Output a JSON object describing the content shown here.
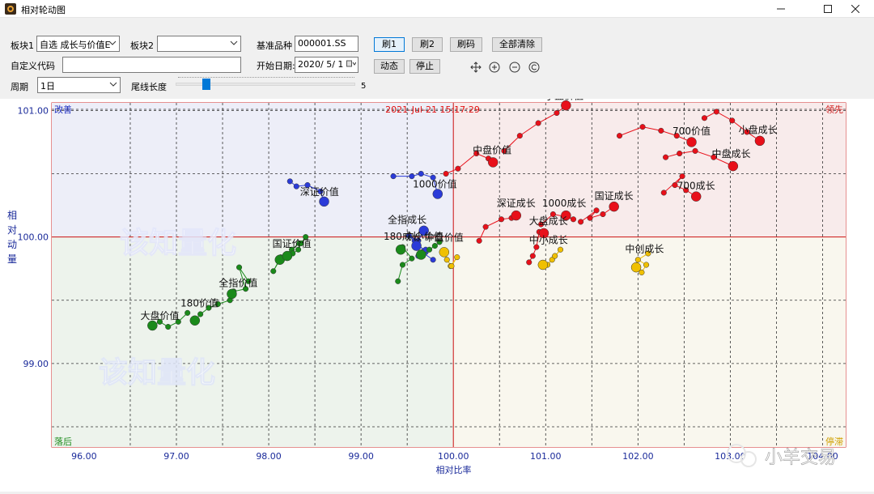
{
  "window": {
    "title": "相对轮动图"
  },
  "controls": {
    "block1_label": "板块1",
    "block1_value": "自选 成长与价值E",
    "block2_label": "板块2",
    "block2_value": "",
    "benchmark_label": "基准品种",
    "benchmark_value": "000001.SS",
    "custom_code_label": "自定义代码",
    "custom_code_value": "",
    "start_date_label": "开始日期:",
    "start_date_value": "2020/ 5/ 1",
    "period_label": "周期",
    "period_value": "1日",
    "tail_label": "尾线长度",
    "tail_value": "5",
    "tail_fraction": 0.17,
    "btn_refresh1": "刷1",
    "btn_refresh2": "刷2",
    "btn_refresh_code": "刷码",
    "btn_clear_all": "全部清除",
    "btn_animate": "动态",
    "btn_stop": "停止",
    "icons": [
      "move-icon",
      "zoom-in-icon",
      "zoom-out-icon",
      "reset-icon"
    ]
  },
  "chart_data": {
    "type": "scatter",
    "timestamp": "2021-Jul-21 15:17:29",
    "xlabel": "相对比率",
    "ylabel": "相对动量",
    "xlim": [
      95.65,
      104.25
    ],
    "ylim": [
      98.34,
      101.06
    ],
    "x_ticks": [
      "96.00",
      "97.00",
      "98.00",
      "99.00",
      "100.00",
      "101.00",
      "102.00",
      "103.00",
      "104.00"
    ],
    "y_ticks": [
      "99.00",
      "100.00",
      "101.00"
    ],
    "quadrant_labels": {
      "top_left": "改善",
      "top_right": "领先",
      "bottom_left": "落后",
      "bottom_right": "停滞"
    },
    "watermarks": [
      "该知量化",
      "该知量化"
    ],
    "overlay_text": "小羊交易",
    "colors": {
      "blue": "#2b3bd8",
      "red": "#e8101a",
      "green": "#1a8a1a",
      "yellow": "#f0c000",
      "axis": "#1a2a9a",
      "quadrant_line": "#cc1010"
    },
    "series": [
      {
        "name": "深证价值",
        "color": "blue",
        "points": [
          [
            98.23,
            100.44
          ],
          [
            98.3,
            100.4
          ],
          [
            98.42,
            100.41
          ],
          [
            98.56,
            100.36
          ],
          [
            98.6,
            100.28
          ]
        ]
      },
      {
        "name": "1000价值",
        "color": "blue",
        "points": [
          [
            99.35,
            100.48
          ],
          [
            99.55,
            100.48
          ],
          [
            99.65,
            100.5
          ],
          [
            99.78,
            100.47
          ],
          [
            99.83,
            100.34
          ]
        ]
      },
      {
        "name": "全指成长",
        "color": "blue",
        "points": [
          [
            99.7,
            99.88
          ],
          [
            99.58,
            99.97
          ],
          [
            99.52,
            100.01
          ],
          [
            99.62,
            99.97
          ],
          [
            99.68,
            100.05
          ]
        ]
      },
      {
        "name": "180成长",
        "color": "blue",
        "points": [
          [
            99.78,
            99.82
          ],
          [
            99.66,
            99.88
          ],
          [
            99.62,
            99.85
          ],
          [
            99.7,
            99.9
          ],
          [
            99.6,
            99.93
          ]
        ]
      },
      {
        "name": "小盘价值",
        "color": "red",
        "points": [
          [
            100.55,
            100.68
          ],
          [
            100.72,
            100.8
          ],
          [
            100.92,
            100.9
          ],
          [
            101.12,
            100.98
          ],
          [
            101.22,
            101.04
          ]
        ]
      },
      {
        "name": "中盘价值",
        "color": "red",
        "points": [
          [
            99.92,
            100.5
          ],
          [
            100.05,
            100.54
          ],
          [
            100.25,
            100.66
          ],
          [
            100.38,
            100.62
          ],
          [
            100.43,
            100.59
          ]
        ]
      },
      {
        "name": "700价值",
        "color": "red",
        "points": [
          [
            101.8,
            100.8
          ],
          [
            102.05,
            100.87
          ],
          [
            102.25,
            100.84
          ],
          [
            102.42,
            100.8
          ],
          [
            102.58,
            100.75
          ]
        ]
      },
      {
        "name": "小盘成长",
        "color": "red",
        "points": [
          [
            102.72,
            100.94
          ],
          [
            102.85,
            100.99
          ],
          [
            103.02,
            100.92
          ],
          [
            103.18,
            100.83
          ],
          [
            103.32,
            100.76
          ]
        ]
      },
      {
        "name": "中盘成长",
        "color": "red",
        "points": [
          [
            102.3,
            100.63
          ],
          [
            102.45,
            100.66
          ],
          [
            102.62,
            100.68
          ],
          [
            102.82,
            100.63
          ],
          [
            103.03,
            100.56
          ]
        ]
      },
      {
        "name": "700成长",
        "color": "red",
        "points": [
          [
            102.28,
            100.35
          ],
          [
            102.48,
            100.48
          ],
          [
            102.4,
            100.41
          ],
          [
            102.52,
            100.37
          ],
          [
            102.63,
            100.32
          ]
        ]
      },
      {
        "name": "国证成长",
        "color": "red",
        "points": [
          [
            101.38,
            100.12
          ],
          [
            101.55,
            100.21
          ],
          [
            101.48,
            100.15
          ],
          [
            101.62,
            100.18
          ],
          [
            101.74,
            100.24
          ]
        ]
      },
      {
        "name": "深证成长",
        "color": "red",
        "points": [
          [
            100.28,
            99.97
          ],
          [
            100.35,
            100.08
          ],
          [
            100.52,
            100.14
          ],
          [
            100.63,
            100.15
          ],
          [
            100.68,
            100.17
          ]
        ]
      },
      {
        "name": "1000成长",
        "color": "red",
        "points": [
          [
            100.95,
            100.1
          ],
          [
            101.08,
            100.18
          ],
          [
            101.22,
            100.16
          ],
          [
            101.3,
            100.14
          ],
          [
            101.22,
            100.17
          ]
        ]
      },
      {
        "name": "大盘成长",
        "color": "red",
        "points": [
          [
            100.82,
            99.8
          ],
          [
            100.86,
            99.85
          ],
          [
            100.9,
            99.92
          ],
          [
            100.93,
            100.04
          ],
          [
            100.98,
            100.03
          ]
        ]
      },
      {
        "name": "中小成长",
        "color": "yellow",
        "points": [
          [
            101.07,
            99.82
          ],
          [
            101.16,
            99.9
          ],
          [
            101.1,
            99.85
          ],
          [
            101.02,
            99.78
          ],
          [
            100.97,
            99.78
          ]
        ]
      },
      {
        "name": "中创成长",
        "color": "yellow",
        "points": [
          [
            102.11,
            99.87
          ],
          [
            102.0,
            99.82
          ],
          [
            102.09,
            99.78
          ],
          [
            102.04,
            99.72
          ],
          [
            101.98,
            99.76
          ]
        ]
      },
      {
        "name": "中盘价值",
        "color": "yellow",
        "points": [
          [
            99.97,
            99.77
          ],
          [
            100.04,
            99.84
          ],
          [
            99.98,
            99.77
          ],
          [
            99.93,
            99.82
          ],
          [
            99.9,
            99.88
          ]
        ]
      },
      {
        "name": "大盘价值",
        "color": "green",
        "points": [
          [
            97.12,
            99.4
          ],
          [
            97.02,
            99.33
          ],
          [
            96.91,
            99.29
          ],
          [
            96.82,
            99.33
          ],
          [
            96.74,
            99.3
          ]
        ]
      },
      {
        "name": "180价值",
        "color": "green",
        "points": [
          [
            97.58,
            99.5
          ],
          [
            97.45,
            99.47
          ],
          [
            97.35,
            99.44
          ],
          [
            97.26,
            99.39
          ],
          [
            97.2,
            99.34
          ]
        ]
      },
      {
        "name": "全指价值",
        "color": "green",
        "points": [
          [
            97.78,
            99.65
          ],
          [
            97.68,
            99.76
          ],
          [
            97.75,
            99.59
          ],
          [
            97.62,
            99.57
          ],
          [
            97.6,
            99.55
          ]
        ]
      },
      {
        "name": "国证价值",
        "color": "green",
        "points": [
          [
            98.33,
            99.95
          ],
          [
            98.25,
            99.9
          ],
          [
            98.13,
            99.84
          ],
          [
            98.05,
            99.73
          ],
          [
            98.12,
            99.82
          ]
        ]
      },
      {
        "name": "全指价值",
        "color": "green",
        "points": [
          [
            98.4,
            100.0
          ],
          [
            98.35,
            99.95
          ],
          [
            98.32,
            99.9
          ],
          [
            98.26,
            99.87
          ],
          [
            98.2,
            99.85
          ]
        ]
      },
      {
        "name": "中盘成长",
        "color": "green",
        "points": [
          [
            99.4,
            99.65
          ],
          [
            99.45,
            99.78
          ],
          [
            99.55,
            99.83
          ],
          [
            99.45,
            99.92
          ],
          [
            99.43,
            99.9
          ]
        ]
      },
      {
        "name": "中小价值",
        "color": "green",
        "points": [
          [
            99.85,
            99.96
          ],
          [
            99.8,
            99.93
          ],
          [
            99.74,
            99.9
          ],
          [
            99.67,
            99.85
          ],
          [
            99.65,
            99.86
          ]
        ]
      }
    ],
    "labels": [
      {
        "text": "深证价值",
        "x": 98.55,
        "y": 100.33
      },
      {
        "text": "1000价值",
        "x": 99.8,
        "y": 100.39
      },
      {
        "text": "全指成长",
        "x": 99.5,
        "y": 100.11
      },
      {
        "text": "180成长",
        "x": 99.45,
        "y": 99.98
      },
      {
        "text": "中小价值",
        "x": 99.68,
        "y": 99.98
      },
      {
        "text": "中盘价值",
        "x": 99.9,
        "y": 99.97
      },
      {
        "text": "小盘价值",
        "x": 101.2,
        "y": 101.09
      },
      {
        "text": "中盘价值",
        "x": 100.42,
        "y": 100.66
      },
      {
        "text": "700价值",
        "x": 102.58,
        "y": 100.81
      },
      {
        "text": "小盘成长",
        "x": 103.3,
        "y": 100.82
      },
      {
        "text": "中盘成长",
        "x": 103.01,
        "y": 100.63
      },
      {
        "text": "700成长",
        "x": 102.63,
        "y": 100.38
      },
      {
        "text": "国证成长",
        "x": 101.74,
        "y": 100.3
      },
      {
        "text": "深证成长",
        "x": 100.68,
        "y": 100.24
      },
      {
        "text": "1000成长",
        "x": 101.2,
        "y": 100.24
      },
      {
        "text": "大盘成长",
        "x": 101.03,
        "y": 100.1
      },
      {
        "text": "中小成长",
        "x": 101.03,
        "y": 99.95
      },
      {
        "text": "中创成长",
        "x": 102.07,
        "y": 99.88
      },
      {
        "text": "国证价值",
        "x": 98.25,
        "y": 99.92
      },
      {
        "text": "全指价值",
        "x": 97.67,
        "y": 99.61
      },
      {
        "text": "180价值",
        "x": 97.25,
        "y": 99.45
      },
      {
        "text": "大盘价值",
        "x": 96.82,
        "y": 99.35
      }
    ]
  }
}
